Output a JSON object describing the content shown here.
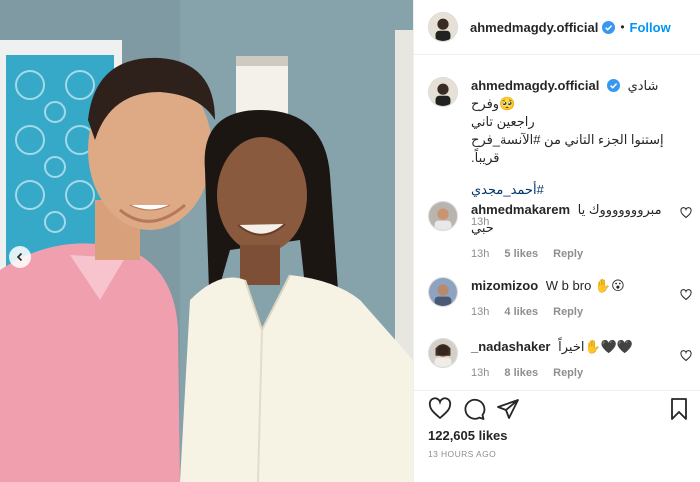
{
  "post": {
    "author": "ahmedmagdy.official",
    "follow_label": "Follow",
    "dot": "•",
    "caption_line1": "شادي وفرح🥺",
    "caption_line2": "راجعين تاني",
    "caption_line3": "إستنوا الجزء التاني من #الآنسة_فرح قريباً.",
    "caption_tag": "#أحمد_مجدي",
    "caption_time": "13h",
    "likes_count": "122,605 likes",
    "posted_ago": "13 HOURS AGO"
  },
  "comments": [
    {
      "user": "ahmedmakarem",
      "text": "مبروووووووك يا حبي",
      "time": "13h",
      "likes": "5 likes",
      "reply": "Reply"
    },
    {
      "user": "mizomizoo",
      "text": "W b bro ✋😮",
      "time": "13h",
      "likes": "4 likes",
      "reply": "Reply"
    },
    {
      "user": "_nadashaker",
      "text": "اخيراً✋🖤🖤",
      "time": "13h",
      "likes": "8 likes",
      "reply": "Reply"
    }
  ],
  "colors": {
    "link_blue": "#0095f6",
    "verified_blue": "#3897f0",
    "muted": "#8e8e8e",
    "text": "#262626"
  }
}
